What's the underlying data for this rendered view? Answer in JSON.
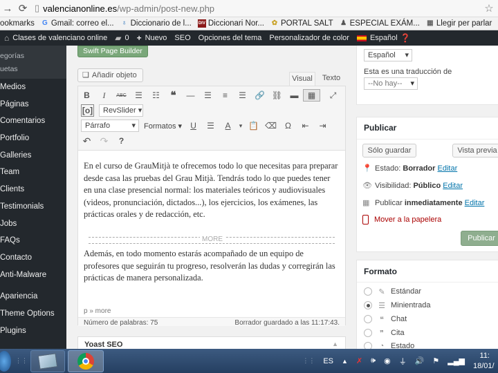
{
  "browser": {
    "url_domain": "valencianonline.es",
    "url_path": "/wp-admin/post-new.php",
    "bookmarks": [
      {
        "label": "ookmarks",
        "icon": ""
      },
      {
        "label": "Gmail: correo el...",
        "icon": "G"
      },
      {
        "label": "Diccionario de l...",
        "icon": "♁"
      },
      {
        "label": "Diccionari Nor...",
        "icon": "DIV"
      },
      {
        "label": "PORTAL SALT",
        "icon": "✿"
      },
      {
        "label": "ESPECIAL EXÁM...",
        "icon": "♟"
      },
      {
        "label": "Llegir per parlar",
        "icon": "▦"
      }
    ]
  },
  "adminbar": {
    "site": "Clases de valenciano online",
    "comments_count": "0",
    "new": "Nuevo",
    "seo": "SEO",
    "theme_options": "Opciones del tema",
    "colors": "Personalizador de color",
    "language": "Español"
  },
  "sidebar": {
    "sub": [
      "egorías",
      "uetas"
    ],
    "items": [
      "Medios",
      "Páginas",
      "Comentarios",
      "Portfolio",
      "Galleries",
      "Team",
      "Clients",
      "Testimonials",
      "Jobs",
      "FAQs",
      "Contacto",
      "Anti-Malware",
      "Apariencia",
      "Theme Options",
      "Plugins"
    ]
  },
  "editor": {
    "swift_label": "Swift Page Builder",
    "add_media": "Añadir objeto",
    "tab_visual": "Visual",
    "tab_text": "Texto",
    "revslider": "RevSlider",
    "paragraph": "Párrafo",
    "formats": "Formatos",
    "content_1": "En el curso de GrauMitjà te ofrecemos todo lo que necesitas para preparar desde casa las pruebas del Grau Mitjà. Tendrás todo lo que puedes tener en una clase presencial normal: los materiales teóricos y audiovisuales (videos, pronunciación, dictados...), los ejercicios, los exámenes, las prácticas orales y de redacción, etc.",
    "more_label": "MORE",
    "content_2": "Además, en todo momento estarás acompañado de un equipo de profesores que seguirán tu progreso, resolverán las dudas y corregirán las prácticas de manera personalizada.",
    "path": "p » more",
    "word_count": "Número de palabras: 75",
    "saved": "Borrador guardado a las 11:17:43."
  },
  "yoast_title": "Yoast SEO",
  "language_box": {
    "language": "Español",
    "translation_label": "Esta es una traducción de",
    "translation_value": "--No hay--"
  },
  "publish": {
    "title": "Publicar",
    "save_draft": "Sólo guardar",
    "preview": "Vista previa",
    "status_label": "Estado:",
    "status_value": "Borrador",
    "visibility_label": "Visibilidad:",
    "visibility_value": "Público",
    "schedule_label": "Publicar",
    "schedule_value": "inmediatamente",
    "edit": "Editar",
    "trash": "Mover a la papelera",
    "publish_btn": "Publicar"
  },
  "format": {
    "title": "Formato",
    "options": [
      {
        "label": "Estándar",
        "icon": "✎",
        "selected": false
      },
      {
        "label": "Minientrada",
        "icon": "☰",
        "selected": true
      },
      {
        "label": "Chat",
        "icon": "❝",
        "selected": false
      },
      {
        "label": "Cita",
        "icon": "❞",
        "selected": false
      },
      {
        "label": "Estado",
        "icon": "◔",
        "selected": false
      }
    ]
  },
  "taskbar": {
    "lang": "ES",
    "time": "11:",
    "date": "18/01/"
  },
  "colors": {
    "admin_dark": "#23282d",
    "link": "#0073aa",
    "trash": "#aa0000"
  }
}
